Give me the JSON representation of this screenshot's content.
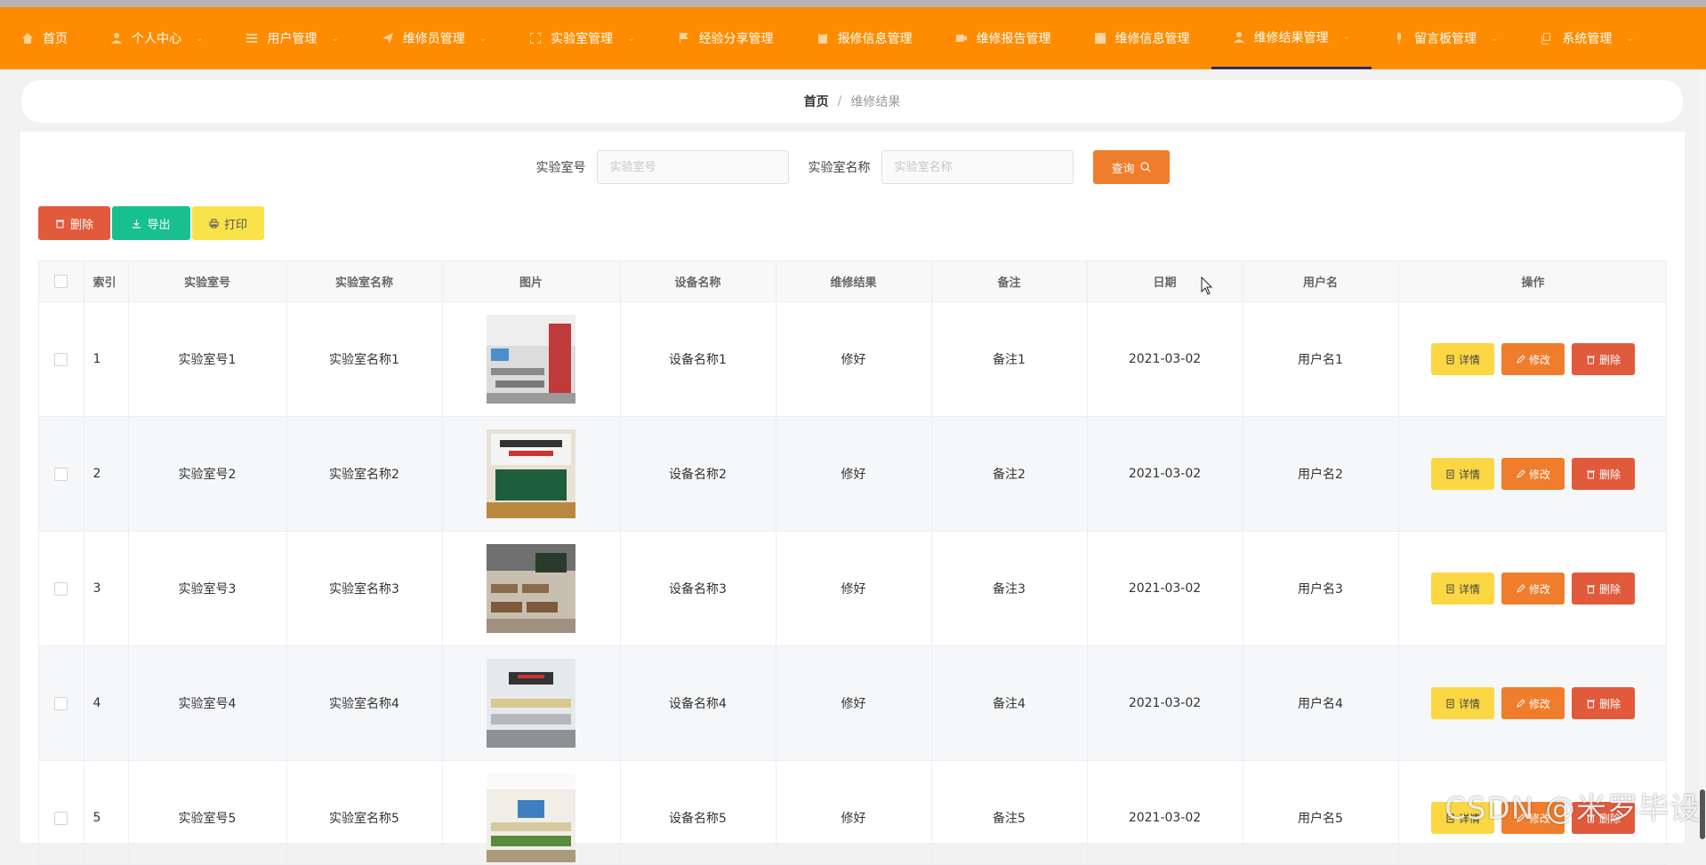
{
  "nav": {
    "items": [
      {
        "label": "首页",
        "icon": "home-icon",
        "has_arrow": false,
        "active": false
      },
      {
        "label": "个人中心",
        "icon": "user-icon",
        "has_arrow": true,
        "active": false
      },
      {
        "label": "用户管理",
        "icon": "list-icon",
        "has_arrow": true,
        "active": false
      },
      {
        "label": "维修员管理",
        "icon": "send-icon",
        "has_arrow": true,
        "active": false
      },
      {
        "label": "实验室管理",
        "icon": "box-dashed-icon",
        "has_arrow": true,
        "active": false
      },
      {
        "label": "经验分享管理",
        "icon": "flag-icon",
        "has_arrow": false,
        "active": false
      },
      {
        "label": "报修信息管理",
        "icon": "clipboard-icon",
        "has_arrow": false,
        "active": false
      },
      {
        "label": "维修报告管理",
        "icon": "video-camera-icon",
        "has_arrow": false,
        "active": false
      },
      {
        "label": "维修信息管理",
        "icon": "square-icon",
        "has_arrow": false,
        "active": false
      },
      {
        "label": "维修结果管理",
        "icon": "user-icon",
        "has_arrow": true,
        "active": true
      },
      {
        "label": "留言板管理",
        "icon": "microphone-icon",
        "has_arrow": true,
        "active": false
      },
      {
        "label": "系统管理",
        "icon": "copy-icon",
        "has_arrow": true,
        "active": false
      }
    ]
  },
  "breadcrumb": {
    "home": "首页",
    "separator": "/",
    "current": "维修结果"
  },
  "search": {
    "lab_no_label": "实验室号",
    "lab_no_placeholder": "实验室号",
    "lab_no_value": "",
    "lab_name_label": "实验室名称",
    "lab_name_placeholder": "实验室名称",
    "lab_name_value": "",
    "query_label": "查询"
  },
  "toolbar": {
    "delete_label": "删除",
    "export_label": "导出",
    "print_label": "打印"
  },
  "table": {
    "headers": [
      "索引",
      "实验室号",
      "实验室名称",
      "图片",
      "设备名称",
      "维修结果",
      "备注",
      "日期",
      "用户名",
      "操作"
    ],
    "rows": [
      {
        "index": "1",
        "lab_no": "实验室号1",
        "lab_name": "实验室名称1",
        "device": "设备名称1",
        "result": "修好",
        "remark": "备注1",
        "date": "2021-03-02",
        "username": "用户名1"
      },
      {
        "index": "2",
        "lab_no": "实验室号2",
        "lab_name": "实验室名称2",
        "device": "设备名称2",
        "result": "修好",
        "remark": "备注2",
        "date": "2021-03-02",
        "username": "用户名2"
      },
      {
        "index": "3",
        "lab_no": "实验室号3",
        "lab_name": "实验室名称3",
        "device": "设备名称3",
        "result": "修好",
        "remark": "备注3",
        "date": "2021-03-02",
        "username": "用户名3"
      },
      {
        "index": "4",
        "lab_no": "实验室号4",
        "lab_name": "实验室名称4",
        "device": "设备名称4",
        "result": "修好",
        "remark": "备注4",
        "date": "2021-03-02",
        "username": "用户名4"
      },
      {
        "index": "5",
        "lab_no": "实验室号5",
        "lab_name": "实验室名称5",
        "device": "设备名称5",
        "result": "修好",
        "remark": "备注5",
        "date": "2021-03-02",
        "username": "用户名5"
      }
    ],
    "actions": {
      "detail": "详情",
      "edit": "修改",
      "delete": "删除"
    }
  },
  "watermark": "CSDN @米罗毕设",
  "colors": {
    "nav_bg": "#ff8c00",
    "delete": "#e25a3c",
    "export": "#17c08e",
    "print": "#f8e34b",
    "edit": "#ef7d2c",
    "detail": "#fbd843"
  }
}
